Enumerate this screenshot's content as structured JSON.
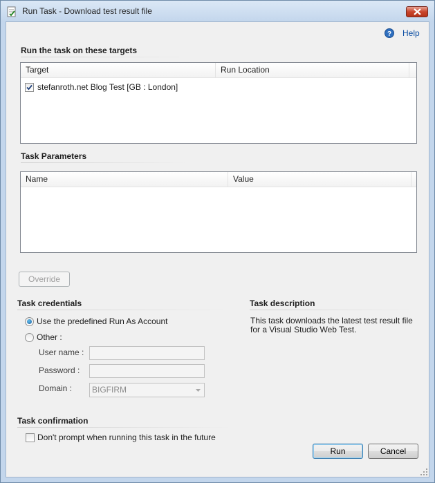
{
  "window": {
    "title": "Run Task - Download test result file",
    "close_icon": "close-icon"
  },
  "help": {
    "label": "Help",
    "icon": "help-icon"
  },
  "targets": {
    "section_title": "Run the task on these targets",
    "columns": [
      "Target",
      "Run Location"
    ],
    "rows": [
      {
        "checked": true,
        "target": "stefanroth.net Blog Test [GB : London]",
        "run_location": ""
      }
    ]
  },
  "parameters": {
    "section_title": "Task Parameters",
    "columns": [
      "Name",
      "Value"
    ],
    "rows": []
  },
  "override_button": "Override",
  "credentials": {
    "section_title": "Task credentials",
    "option_predefined": "Use the predefined Run As Account",
    "option_other": "Other :",
    "selected": "predefined",
    "user_name_label": "User name :",
    "password_label": "Password :",
    "domain_label": "Domain :",
    "domain_value": "BIGFIRM",
    "user_name_value": "",
    "password_value": ""
  },
  "description": {
    "section_title": "Task description",
    "text": "This task downloads the latest test result file for a Visual Studio Web Test."
  },
  "confirmation": {
    "section_title": "Task confirmation",
    "dont_prompt_label": "Don't prompt when running this task in the future",
    "dont_prompt_checked": false
  },
  "buttons": {
    "run": "Run",
    "cancel": "Cancel"
  },
  "colors": {
    "link": "#0c4ea3",
    "client_bg": "#f0f0f0",
    "frame": "#c3d6ec",
    "close": "#c9452c"
  }
}
